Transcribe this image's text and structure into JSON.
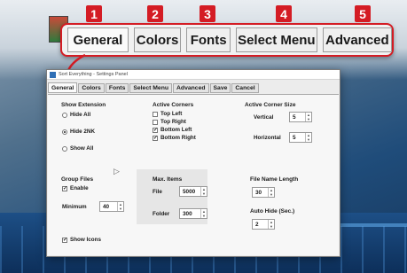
{
  "callout": {
    "tabs": [
      "General",
      "Colors",
      "Fonts",
      "Select Menu",
      "Advanced"
    ],
    "badges": [
      "1",
      "2",
      "3",
      "4",
      "5"
    ]
  },
  "dialog": {
    "title": "Sort Everything - Settings Panel",
    "tabs": [
      "General",
      "Colors",
      "Fonts",
      "Select Menu",
      "Advanced",
      "Save",
      "Cancel"
    ],
    "show_extension": {
      "title": "Show Extension",
      "options": [
        "Hide All",
        "Hide 2NK",
        "Show All"
      ],
      "selected": "Hide 2NK"
    },
    "active_corners": {
      "title": "Active Corners",
      "options": [
        {
          "label": "Top Left",
          "checked": false
        },
        {
          "label": "Top Right",
          "checked": false
        },
        {
          "label": "Bottom Left",
          "checked": true
        },
        {
          "label": "Bottom Right",
          "checked": true
        }
      ]
    },
    "active_corner_size": {
      "title": "Active Corner Size",
      "vertical_label": "Vertical",
      "vertical_value": "5",
      "horizontal_label": "Horizontal",
      "horizontal_value": "5"
    },
    "group_files": {
      "title": "Group Files",
      "enable_label": "Enable",
      "enable_checked": true,
      "minimum_label": "Minimum",
      "minimum_value": "40"
    },
    "max_items": {
      "title": "Max. Items",
      "file_label": "File",
      "file_value": "5000",
      "folder_label": "Folder",
      "folder_value": "300"
    },
    "file_name_length": {
      "title": "File Name Length",
      "value": "30"
    },
    "auto_hide": {
      "title": "Auto Hide (Sec.)",
      "value": "2"
    },
    "show_icons": {
      "label": "Show Icons",
      "checked": true
    }
  },
  "colors": {
    "accent": "#d41c24"
  }
}
